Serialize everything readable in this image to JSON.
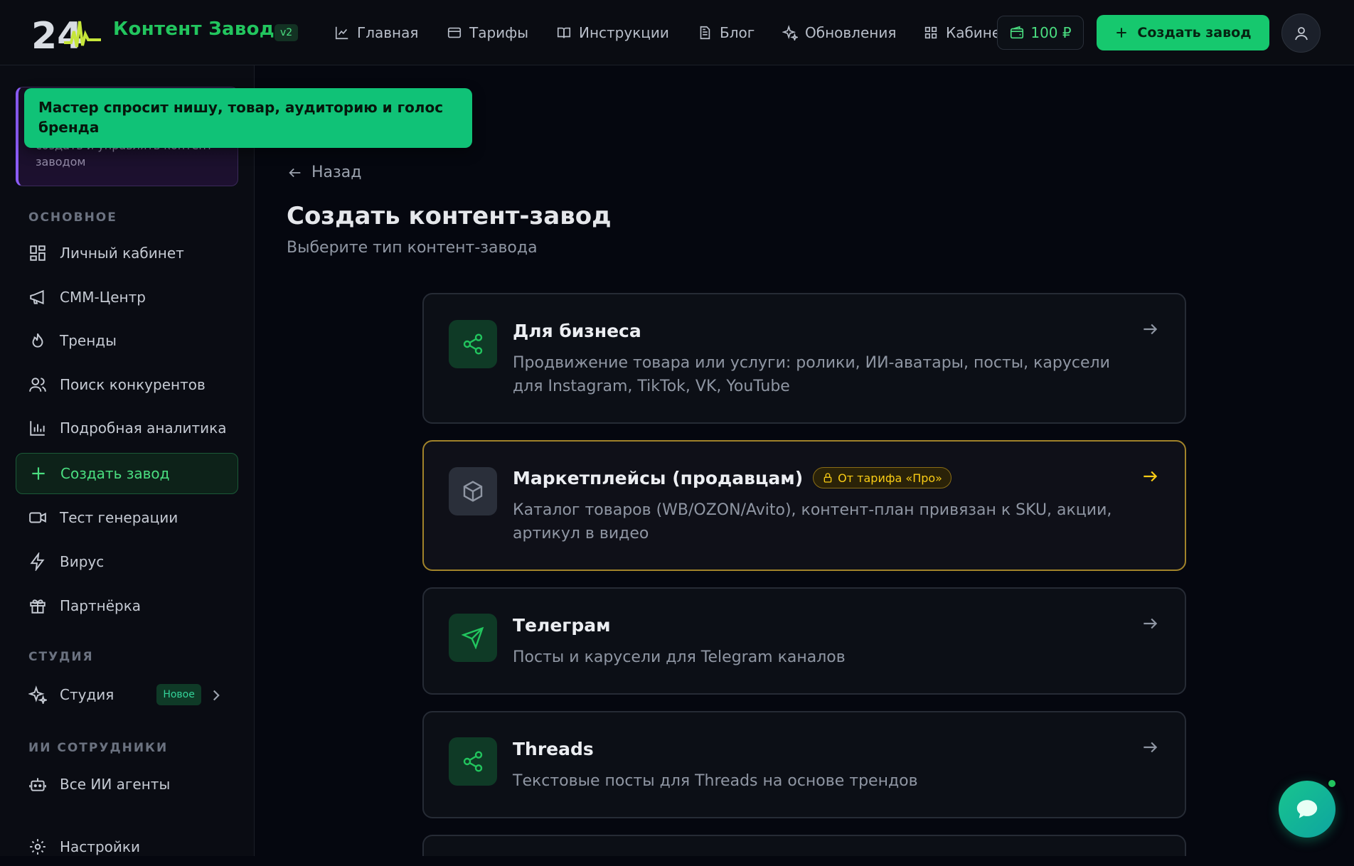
{
  "header": {
    "brand": "Контент Завод",
    "version": "v2",
    "nav": [
      {
        "label": "Главная",
        "icon": "chart-icon"
      },
      {
        "label": "Тарифы",
        "icon": "card-icon"
      },
      {
        "label": "Инструкции",
        "icon": "book-icon"
      },
      {
        "label": "Блог",
        "icon": "document-icon"
      },
      {
        "label": "Обновления",
        "icon": "sparkle-icon"
      },
      {
        "label": "Кабинет",
        "icon": "grid-icon"
      }
    ],
    "balance": "100 ₽",
    "create_button": "Создать завод"
  },
  "tooltip": "Мастер спросит нишу, товар, аудиторию и голос бренда",
  "promo": {
    "text": "создать и управлять контент-заводом"
  },
  "sidebar": {
    "section_main": "ОСНОВНОЕ",
    "items": [
      {
        "label": "Личный кабинет",
        "icon": "grid-icon"
      },
      {
        "label": "СММ-Центр",
        "icon": "megaphone-icon"
      },
      {
        "label": "Тренды",
        "icon": "flame-icon"
      },
      {
        "label": "Поиск конкурентов",
        "icon": "users-icon"
      },
      {
        "label": "Подробная аналитика",
        "icon": "bar-chart-icon"
      },
      {
        "label": "Создать завод",
        "icon": "plus-icon"
      },
      {
        "label": "Тест генерации",
        "icon": "video-icon"
      },
      {
        "label": "Вирус",
        "icon": "lightning-icon"
      },
      {
        "label": "Партнёрка",
        "icon": "gift-icon"
      }
    ],
    "section_studio": "СТУДИЯ",
    "studio": {
      "label": "Студия",
      "badge": "Новое"
    },
    "section_ai": "ИИ СОТРУДНИКИ",
    "ai_agents": "Все ИИ агенты",
    "settings": "Настройки"
  },
  "main": {
    "back": "Назад",
    "title": "Создать контент-завод",
    "subtitle": "Выберите тип контент-завода",
    "cards": [
      {
        "title": "Для бизнеса",
        "desc": "Продвижение товара или услуги: ролики, ИИ-аватары, посты, карусели для Instagram, TikTok, VK, YouTube"
      },
      {
        "title": "Маркетплейсы (продавцам)",
        "badge": "От тарифа «Про»",
        "desc": "Каталог товаров (WB/OZON/Avito), контент-план привязан к SKU, акции, артикул в видео"
      },
      {
        "title": "Телеграм",
        "desc": "Посты и карусели для Telegram каналов"
      },
      {
        "title": "Threads",
        "desc": "Текстовые посты для Threads на основе трендов"
      }
    ]
  },
  "colors": {
    "accent": "#22c55e",
    "pro": "#facc15",
    "background": "#05070f"
  }
}
